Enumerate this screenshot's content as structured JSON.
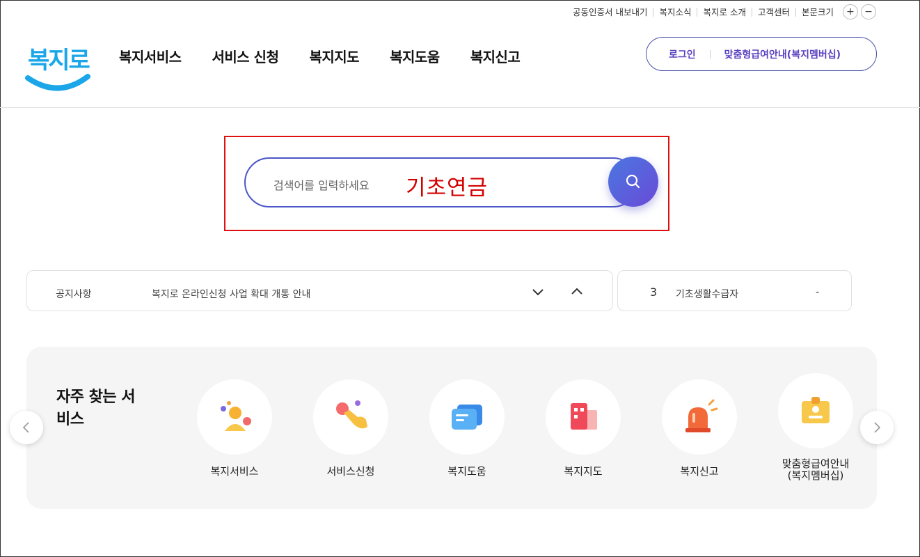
{
  "utility": {
    "items": [
      "공동인증서 내보내기",
      "복지소식",
      "복지로 소개",
      "고객센터",
      "본문크기"
    ],
    "plus": "+",
    "minus": "−"
  },
  "logo": {
    "text": "복지로"
  },
  "gnb": [
    "복지서비스",
    "서비스 신청",
    "복지지도",
    "복지도움",
    "복지신고"
  ],
  "member": {
    "login": "로그인",
    "membership": "맞춤형급여안내(복지멤버십)"
  },
  "search": {
    "placeholder": "검색어를 입력하세요",
    "typed": "기초연금"
  },
  "notice": {
    "label": "공지사항",
    "text": "복지로 온라인신청 사업 확대 개통 안내"
  },
  "ranking": {
    "rank": "3",
    "keyword": "기초생활수급자",
    "change": "-"
  },
  "quick": {
    "title": "자주 찾는 서비스",
    "items": [
      {
        "label": "복지서비스",
        "icon": "person-icon"
      },
      {
        "label": "서비스신청",
        "icon": "hand-tap-icon"
      },
      {
        "label": "복지도움",
        "icon": "chat-bubble-icon"
      },
      {
        "label": "복지지도",
        "icon": "building-icon"
      },
      {
        "label": "복지신고",
        "icon": "siren-icon"
      },
      {
        "label": "맞춤형급여안내\n(복지멤버십)",
        "icon": "id-card-icon"
      }
    ]
  },
  "colors": {
    "accent": "#4a56c8",
    "membership_text": "#5a3fc0",
    "annotation_red": "#e01010",
    "logo_blue": "#1aa6e8"
  }
}
